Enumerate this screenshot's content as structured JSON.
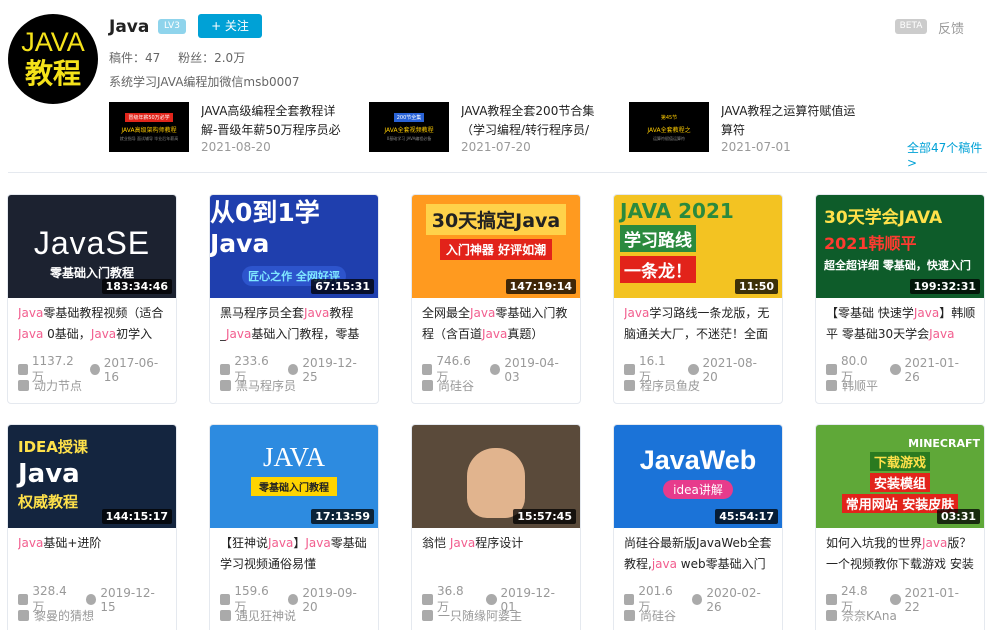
{
  "profile": {
    "avatar_line1": "JAVA",
    "avatar_line2": "教程",
    "name": "Java",
    "level": "LV3",
    "follow_label": "+ 关注",
    "posts_label": "稿件：47",
    "fans_label": "粉丝：2.0万",
    "sign": "系统学习JAVA编程加微信msb0007",
    "beta": "BETA",
    "feedback": "反馈"
  },
  "recent": [
    {
      "thumb_tag": "冒级年薪50万必学",
      "thumb_main": "JAVA高级架构师教程",
      "thumb_sub": "就业指导 面试辅导 毕业后年薪高",
      "title": "JAVA高级编程全套教程详解-晋级年薪50万程序员必",
      "date": "2021-08-20"
    },
    {
      "thumb_tag": "200节全集",
      "thumb_main": "JAVA全套视频教程",
      "thumb_sub": "0基础学习 JAVA编程必备",
      "title": "JAVA教程全套200节合集（学习编程/转行程序员/",
      "date": "2021-07-20"
    },
    {
      "thumb_tag": "第45节",
      "thumb_main": "JAVA全套教程之",
      "thumb_sub": "运算符赋值运算符",
      "title": "JAVA教程之运算符赋值运算符",
      "date": "2021-07-01"
    }
  ],
  "all_posts_link": "全部47个稿件>",
  "videos": [
    {
      "cover_text": [
        "JavaSE",
        "零基础入门教程"
      ],
      "duration": "183:34:46",
      "title_parts": [
        [
          "Java",
          true
        ],
        [
          "零基础教程视频（适合",
          false
        ],
        [
          "Java",
          true
        ],
        [
          " 0基础，",
          false
        ],
        [
          "Java",
          true
        ],
        [
          "初学入",
          false
        ]
      ],
      "plays": "1137.2万",
      "date": "2017-06-16",
      "uploader": "动力节点"
    },
    {
      "cover_text": [
        "从0到1学Java",
        "匠心之作 全网好评"
      ],
      "duration": "67:15:31",
      "title_parts": [
        [
          "黑马程序员全套",
          false
        ],
        [
          "Java",
          true
        ],
        [
          "教程_",
          false
        ],
        [
          "Java",
          true
        ],
        [
          "基础入门教程，零基",
          false
        ]
      ],
      "plays": "233.6万",
      "date": "2019-12-25",
      "uploader": "黑马程序员"
    },
    {
      "cover_text": [
        "30天搞定Java",
        "入门神器 好评如潮"
      ],
      "duration": "147:19:14",
      "title_parts": [
        [
          "全网最全",
          false
        ],
        [
          "Java",
          true
        ],
        [
          "零基础入门教程（含百道",
          false
        ],
        [
          "Java",
          true
        ],
        [
          "真题）",
          false
        ]
      ],
      "plays": "746.6万",
      "date": "2019-04-03",
      "uploader": "尚硅谷"
    },
    {
      "cover_text": [
        "JAVA 2021",
        "学习路线",
        "一条龙！"
      ],
      "duration": "11:50",
      "title_parts": [
        [
          "Java",
          true
        ],
        [
          "学习路线一条龙版，无脑通关大厂，不迷茫！全面",
          false
        ]
      ],
      "plays": "16.1万",
      "date": "2021-08-20",
      "uploader": "程序员鱼皮"
    },
    {
      "cover_text": [
        "30天学会JAVA",
        "2021韩顺平",
        "超全超详细 零基础，快速入门"
      ],
      "duration": "199:32:31",
      "title_parts": [
        [
          "【零基础 快速学",
          false
        ],
        [
          "Java",
          true
        ],
        [
          "】韩顺平 零基础30天学会",
          false
        ],
        [
          "Java",
          true
        ]
      ],
      "plays": "80.0万",
      "date": "2021-01-26",
      "uploader": "韩顺平"
    },
    {
      "cover_text": [
        "IDEA授课",
        "Java",
        "权威教程"
      ],
      "duration": "144:15:17",
      "title_parts": [
        [
          "Java",
          true
        ],
        [
          "基础+进阶",
          false
        ]
      ],
      "plays": "328.4万",
      "date": "2019-12-15",
      "uploader": "黎曼的猜想"
    },
    {
      "cover_text": [
        "JAVA",
        "零基础入门教程"
      ],
      "duration": "17:13:59",
      "title_parts": [
        [
          "【狂神说",
          false
        ],
        [
          "Java",
          true
        ],
        [
          "】",
          false
        ],
        [
          "Java",
          true
        ],
        [
          "零基础学习视频通俗易懂",
          false
        ]
      ],
      "plays": "159.6万",
      "date": "2019-09-20",
      "uploader": "遇见狂神说"
    },
    {
      "cover_text": [],
      "duration": "15:57:45",
      "title_parts": [
        [
          "翁恺 ",
          false
        ],
        [
          "Java",
          true
        ],
        [
          "程序设计",
          false
        ]
      ],
      "plays": "36.8万",
      "date": "2019-12-01",
      "uploader": "一只随缘阿婆主"
    },
    {
      "cover_text": [
        "JavaWeb",
        "idea讲解"
      ],
      "duration": "45:54:17",
      "title_parts": [
        [
          "尚硅谷最新版JavaWeb全套教程,",
          false
        ],
        [
          "java",
          true
        ],
        [
          " web零基础入门完",
          false
        ]
      ],
      "plays": "201.6万",
      "date": "2020-02-26",
      "uploader": "尚硅谷"
    },
    {
      "cover_text": [
        "MINECRAFT",
        "下载游戏",
        "安装模组",
        "常用网站 安装皮肤"
      ],
      "duration": "03:31",
      "title_parts": [
        [
          "如何入坑我的世界",
          false
        ],
        [
          "Java",
          true
        ],
        [
          "版？一个视频教你下载游戏 安装",
          false
        ]
      ],
      "plays": "24.8万",
      "date": "2021-01-22",
      "uploader": "奈奈KAna"
    }
  ],
  "colors": {
    "accent": "#00a1d6",
    "highlight": "#f25d8e",
    "muted": "#999999"
  }
}
